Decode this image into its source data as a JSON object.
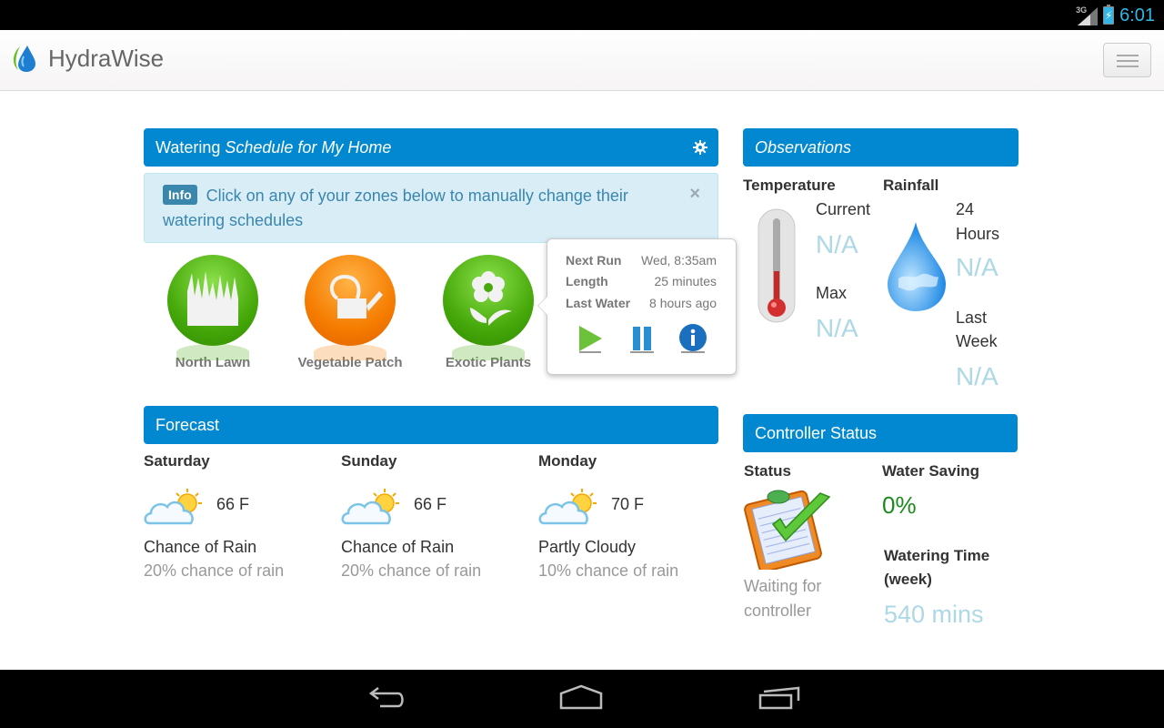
{
  "status_bar": {
    "network": "3G",
    "time": "6:01",
    "icons": [
      "signal-icon",
      "battery-charging-icon"
    ]
  },
  "app": {
    "title": "HydraWise",
    "logo_icon": "water-drop-leaf-icon",
    "menu_icon": "hamburger-menu-icon"
  },
  "schedule": {
    "title_plain": "Watering ",
    "title_italic": "Schedule for My Home",
    "settings_icon": "gear-icon",
    "info": {
      "label": "Info",
      "message": "Click on any of your zones below to manually change their watering schedules",
      "close": "×"
    },
    "zones": [
      {
        "name": "North Lawn",
        "icon": "grass-icon",
        "color": "#4cae0a"
      },
      {
        "name": "Vegetable Patch",
        "icon": "watering-can-icon",
        "color": "#f57c00"
      },
      {
        "name": "Exotic Plants",
        "icon": "flower-icon",
        "color": "#4cae0a"
      }
    ],
    "popover": {
      "rows": [
        {
          "key": "Next Run",
          "value": "Wed, 8:35am"
        },
        {
          "key": "Length",
          "value": "25 minutes"
        },
        {
          "key": "Last Water",
          "value": "8 hours ago"
        }
      ],
      "actions": [
        "play-icon",
        "pause-icon",
        "info-icon"
      ]
    }
  },
  "observations": {
    "title": "Observations",
    "temperature": {
      "heading": "Temperature",
      "current_label": "Current",
      "current_value": "N/A",
      "max_label": "Max",
      "max_value": "N/A"
    },
    "rainfall": {
      "heading": "Rainfall",
      "h24_label_1": "24",
      "h24_label_2": "Hours",
      "h24_value": "N/A",
      "week_label_1": "Last",
      "week_label_2": "Week",
      "week_value": "N/A"
    }
  },
  "forecast": {
    "title": "Forecast",
    "days": [
      {
        "day": "Saturday",
        "temp": "66 F",
        "condition": "Chance of Rain",
        "chance": "20% chance of rain"
      },
      {
        "day": "Sunday",
        "temp": "66 F",
        "condition": "Chance of Rain",
        "chance": "20% chance of rain"
      },
      {
        "day": "Monday",
        "temp": "70 F",
        "condition": "Partly Cloudy",
        "chance": "10% chance of rain"
      }
    ]
  },
  "controller": {
    "title": "Controller Status",
    "status_label": "Status",
    "status_text_1": "Waiting for",
    "status_text_2": "controller",
    "water_saving_label": "Water Saving",
    "water_saving_value": "0%",
    "watering_time_label_1": "Watering Time",
    "watering_time_label_2": "(week)",
    "watering_time_value": "540 mins"
  },
  "nav": [
    "back-icon",
    "home-icon",
    "recent-apps-icon"
  ],
  "colors": {
    "accent": "#0288d1",
    "info_bg": "#d9edf7",
    "info_text": "#3a87ad",
    "na_text": "#add8e6",
    "saving_green": "#1a8a1a"
  }
}
